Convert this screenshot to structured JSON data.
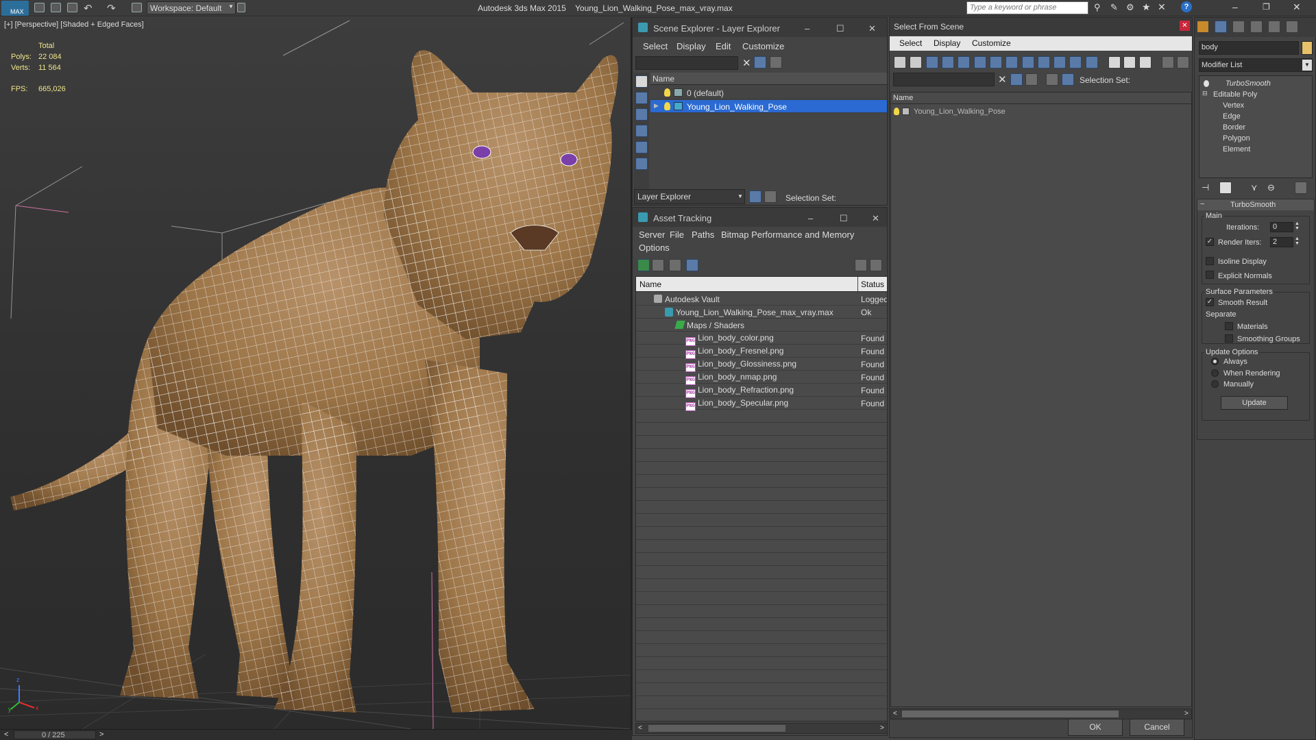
{
  "app": {
    "logo": "MAX",
    "workspace": "Workspace: Default",
    "title_app": "Autodesk 3ds Max  2015",
    "title_file": "Young_Lion_Walking_Pose_max_vray.max",
    "search_placeholder": "Type a keyword or phrase"
  },
  "viewport": {
    "label": "[+] [Perspective] [Shaded + Edged Faces]",
    "stats": {
      "total_label": "Total",
      "polys_label": "Polys:",
      "polys_value": "22 084",
      "verts_label": "Verts:",
      "verts_value": "11 564",
      "fps_label": "FPS:",
      "fps_value": "665,026"
    },
    "time_slider": "0 / 225",
    "axis": {
      "x": "x",
      "y": "y",
      "z": "z"
    }
  },
  "scene_explorer": {
    "title": "Scene Explorer - Layer Explorer",
    "menu": [
      "Select",
      "Display",
      "Edit",
      "Customize"
    ],
    "column_name": "Name",
    "rows": [
      "0 (default)",
      "Young_Lion_Walking_Pose"
    ],
    "footer_dropdown": "Layer Explorer",
    "selection_set": "Selection Set:"
  },
  "asset_tracking": {
    "title": "Asset Tracking",
    "menu": [
      "Server",
      "File",
      "Paths",
      "Bitmap Performance and Memory"
    ],
    "menu2": "Options",
    "col_name": "Name",
    "col_status": "Status",
    "rows": [
      {
        "name": "Autodesk Vault",
        "status": "Logged"
      },
      {
        "name": "Young_Lion_Walking_Pose_max_vray.max",
        "status": "Ok"
      },
      {
        "name": "Maps / Shaders",
        "status": ""
      },
      {
        "name": "Lion_body_color.png",
        "status": "Found"
      },
      {
        "name": "Lion_body_Fresnel.png",
        "status": "Found"
      },
      {
        "name": "Lion_body_Glossiness.png",
        "status": "Found"
      },
      {
        "name": "Lion_body_nmap.png",
        "status": "Found"
      },
      {
        "name": "Lion_body_Refraction.png",
        "status": "Found"
      },
      {
        "name": "Lion_body_Specular.png",
        "status": "Found"
      }
    ],
    "png_tag": "PNG"
  },
  "select_from_scene": {
    "title": "Select From Scene",
    "menu": [
      "Select",
      "Display",
      "Customize"
    ],
    "selection_set": "Selection Set:",
    "column_name": "Name",
    "rows": [
      "Young_Lion_Walking_Pose"
    ],
    "ok": "OK",
    "cancel": "Cancel"
  },
  "command_panel": {
    "object_name": "body",
    "modifier_list": "Modifier List",
    "stack": [
      "TurboSmooth",
      "Editable Poly",
      "Vertex",
      "Edge",
      "Border",
      "Polygon",
      "Element"
    ],
    "rollout_title": "TurboSmooth",
    "main_label": "Main",
    "iterations_label": "Iterations:",
    "iterations_value": "0",
    "render_iters_label": "Render Iters:",
    "render_iters_value": "2",
    "isoline_label": "Isoline Display",
    "explicit_normals_label": "Explicit Normals",
    "surface_params_label": "Surface Parameters",
    "smooth_result_label": "Smooth Result",
    "separate_label": "Separate",
    "materials_label": "Materials",
    "smoothing_groups_label": "Smoothing Groups",
    "update_options_label": "Update Options",
    "always_label": "Always",
    "when_rendering_label": "When Rendering",
    "manually_label": "Manually",
    "update_button": "Update"
  },
  "colors": {
    "selection": "#2a6ad2",
    "accent_blue": "#5a7ba8",
    "lion_body": "#a07a4e",
    "wire": "#ffffff",
    "eye": "#7a3fa8"
  }
}
